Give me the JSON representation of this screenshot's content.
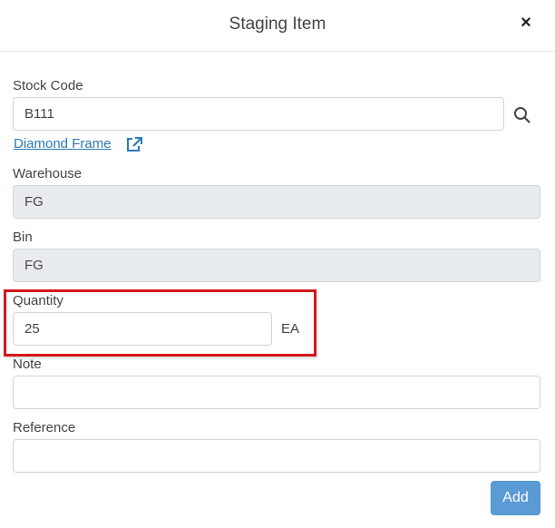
{
  "modal": {
    "title": "Staging Item",
    "close_glyph": "×"
  },
  "stock_code": {
    "label": "Stock Code",
    "value": "B111",
    "search_icon": "search-icon",
    "description_link": "Diamond Frame",
    "link_icon": "external-link-icon"
  },
  "warehouse": {
    "label": "Warehouse",
    "value": "FG"
  },
  "bin": {
    "label": "Bin",
    "value": "FG"
  },
  "quantity": {
    "label": "Quantity",
    "value": "25",
    "unit": "EA"
  },
  "note": {
    "label": "Note",
    "value": ""
  },
  "reference": {
    "label": "Reference",
    "value": ""
  },
  "actions": {
    "add_label": "Add"
  },
  "colors": {
    "link": "#2a7ab8",
    "highlight_border": "#d6161b",
    "add_button": "#5b9bd5",
    "readonly_bg": "#e9ecef"
  }
}
